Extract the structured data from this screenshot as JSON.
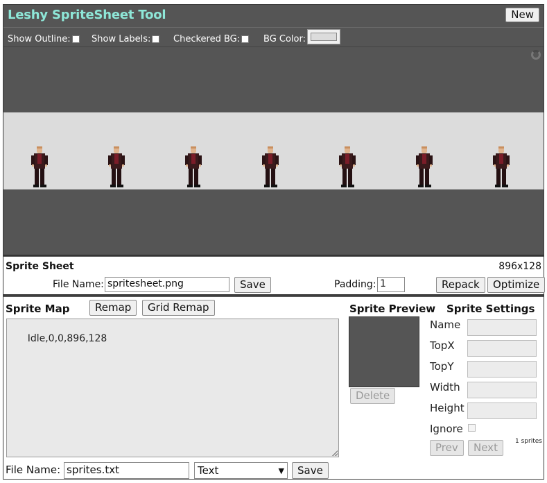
{
  "app": {
    "title": "Leshy SpriteSheet Tool",
    "new_label": "New"
  },
  "toolbar": {
    "show_outline": "Show Outline:",
    "show_labels": "Show Labels:",
    "checkered_bg": "Checkered BG:",
    "bg_color": "BG Color:"
  },
  "sheet": {
    "label": "Sprite Sheet",
    "size": "896x128",
    "file_name_label": "File Name:",
    "file_name_value": "spritesheet.png",
    "save_label": "Save",
    "padding_label": "Padding:",
    "padding_value": "1",
    "repack_label": "Repack",
    "optimize_label": "Optimize",
    "sprite_count": 7
  },
  "map": {
    "title": "Sprite Map",
    "remap_label": "Remap",
    "grid_remap_label": "Grid Remap",
    "content": "Idle,0,0,896,128",
    "file_name_label": "File Name:",
    "file_name_value": "sprites.txt",
    "format_value": "Text",
    "save_label": "Save"
  },
  "preview": {
    "title": "Sprite Preview",
    "delete_label": "Delete"
  },
  "settings": {
    "title": "Sprite Settings",
    "name_label": "Name",
    "topx_label": "TopX",
    "topy_label": "TopY",
    "width_label": "Width",
    "height_label": "Height",
    "ignore_label": "Ignore",
    "prev_label": "Prev",
    "next_label": "Next",
    "count": "1 sprites"
  },
  "colors": {
    "accent": "#8ee7d8",
    "panel": "#555555",
    "sheet_bg": "#dcdcdc"
  }
}
